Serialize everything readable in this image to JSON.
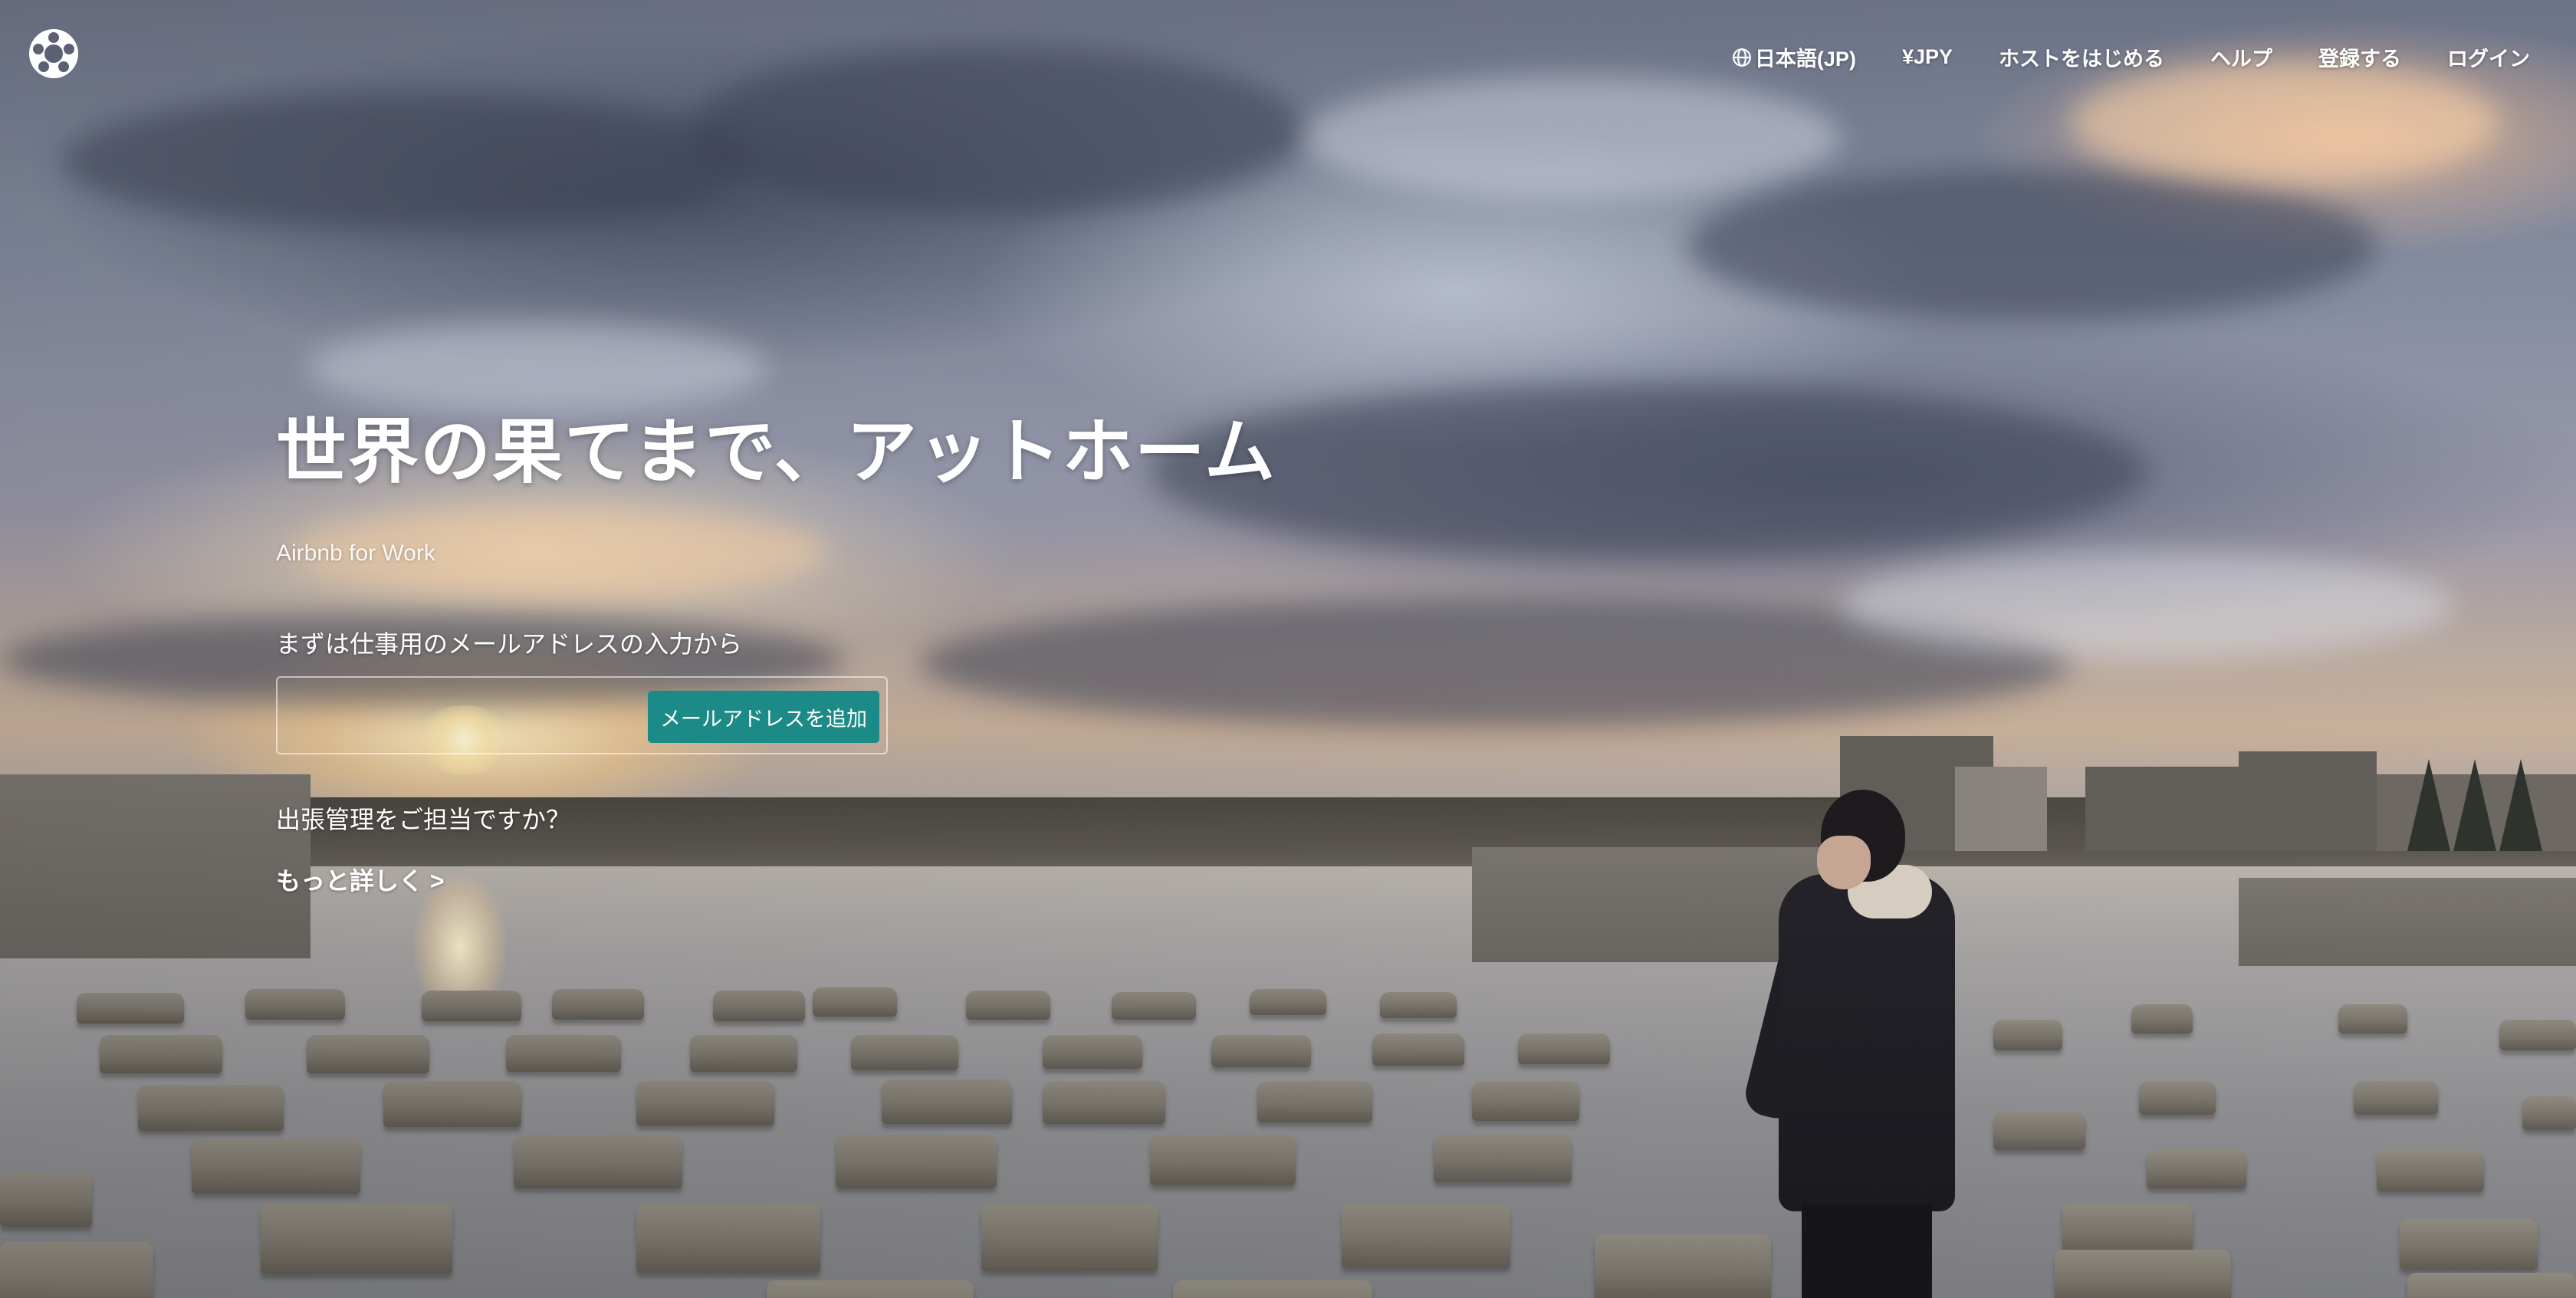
{
  "header": {
    "logo_icon": "airbnb-logo-icon",
    "nav": {
      "language_icon": "globe-icon",
      "language_label": "日本語(JP)",
      "currency_label": "¥JPY",
      "become_host_label": "ホストをはじめる",
      "help_label": "ヘルプ",
      "signup_label": "登録する",
      "login_label": "ログイン"
    }
  },
  "hero": {
    "title": "世界の果てまで、アットホーム",
    "subtitle": "Airbnb for Work"
  },
  "email_signup": {
    "prompt": "まずは仕事用のメールアドレスの入力から",
    "input_value": "",
    "input_placeholder": "",
    "button_label": "メールアドレスを追加",
    "button_color": "#1c8a86"
  },
  "travel_manager": {
    "question": "出張管理をご担当ですか？",
    "link_label": "もっと詳しく >"
  }
}
